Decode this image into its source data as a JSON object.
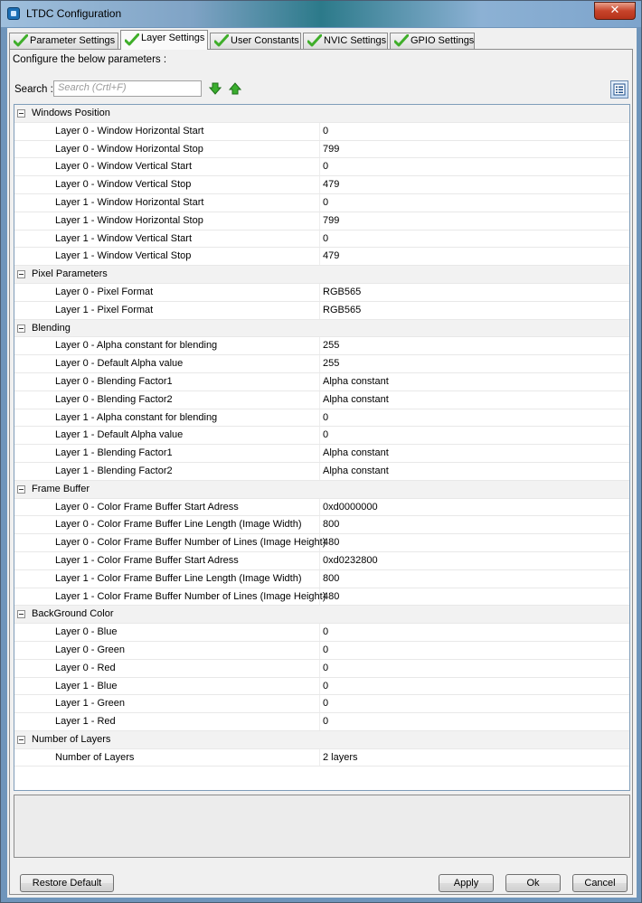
{
  "window": {
    "title": "LTDC Configuration",
    "close_label": "✕"
  },
  "tabs": [
    {
      "label": "Parameter Settings",
      "active": false
    },
    {
      "label": "Layer Settings",
      "active": true
    },
    {
      "label": "User Constants",
      "active": false
    },
    {
      "label": "NVIC Settings",
      "active": false
    },
    {
      "label": "GPIO Settings",
      "active": false
    }
  ],
  "panel": {
    "configure_text": "Configure the below parameters :",
    "search_label": "Search :",
    "search_placeholder": "Search (Crtl+F)"
  },
  "groups": [
    {
      "label": "Windows Position",
      "params": [
        {
          "name": "Layer 0 - Window Horizontal Start",
          "value": "0"
        },
        {
          "name": "Layer 0 - Window Horizontal Stop",
          "value": "799"
        },
        {
          "name": "Layer 0 - Window Vertical Start",
          "value": "0"
        },
        {
          "name": "Layer 0 - Window Vertical Stop",
          "value": "479"
        },
        {
          "name": "Layer 1 - Window Horizontal Start",
          "value": "0"
        },
        {
          "name": "Layer 1 - Window Horizontal Stop",
          "value": "799"
        },
        {
          "name": "Layer 1 - Window Vertical Start",
          "value": "0"
        },
        {
          "name": "Layer 1 - Window Vertical Stop",
          "value": "479"
        }
      ]
    },
    {
      "label": "Pixel Parameters",
      "params": [
        {
          "name": "Layer 0 - Pixel Format",
          "value": "RGB565"
        },
        {
          "name": "Layer 1 - Pixel Format",
          "value": "RGB565"
        }
      ]
    },
    {
      "label": "Blending",
      "params": [
        {
          "name": "Layer 0 - Alpha constant for blending",
          "value": "255"
        },
        {
          "name": "Layer 0 - Default Alpha value",
          "value": "255"
        },
        {
          "name": "Layer 0 - Blending Factor1",
          "value": "Alpha constant"
        },
        {
          "name": "Layer 0 - Blending Factor2",
          "value": "Alpha constant"
        },
        {
          "name": "Layer 1 - Alpha constant for blending",
          "value": "0"
        },
        {
          "name": "Layer 1 - Default Alpha value",
          "value": "0"
        },
        {
          "name": "Layer 1 - Blending Factor1",
          "value": "Alpha constant"
        },
        {
          "name": "Layer 1 - Blending Factor2",
          "value": "Alpha constant"
        }
      ]
    },
    {
      "label": "Frame Buffer",
      "params": [
        {
          "name": "Layer 0 - Color Frame Buffer Start Adress",
          "value": "0xd0000000"
        },
        {
          "name": "Layer 0 - Color Frame Buffer Line Length (Image Width)",
          "value": "800"
        },
        {
          "name": "Layer 0 - Color Frame Buffer Number of Lines (Image Height)",
          "value": "480"
        },
        {
          "name": "Layer 1 - Color Frame Buffer Start Adress",
          "value": "0xd0232800"
        },
        {
          "name": "Layer 1 - Color Frame Buffer Line Length (Image Width)",
          "value": "800"
        },
        {
          "name": "Layer 1 - Color Frame Buffer Number of Lines (Image Height)",
          "value": "480"
        }
      ]
    },
    {
      "label": "BackGround Color",
      "params": [
        {
          "name": "Layer 0 - Blue",
          "value": "0"
        },
        {
          "name": "Layer 0 - Green",
          "value": "0"
        },
        {
          "name": "Layer 0 - Red",
          "value": "0"
        },
        {
          "name": "Layer 1 - Blue",
          "value": "0"
        },
        {
          "name": "Layer 1 - Green",
          "value": "0"
        },
        {
          "name": "Layer 1 - Red",
          "value": "0"
        }
      ]
    },
    {
      "label": "Number of Layers",
      "params": [
        {
          "name": "Number of Layers",
          "value": "2 layers"
        }
      ]
    }
  ],
  "buttons": {
    "restore": "Restore Default",
    "apply": "Apply",
    "ok": "Ok",
    "cancel": "Cancel"
  },
  "icons": {
    "tab_status": "green-check-icon",
    "search_next": "green-arrow-down-icon",
    "search_prev": "green-arrow-up-icon",
    "view_toggle": "list-view-icon"
  },
  "colors": {
    "check_green": "#3fae2a",
    "arrow_green": "#2fa52a"
  }
}
